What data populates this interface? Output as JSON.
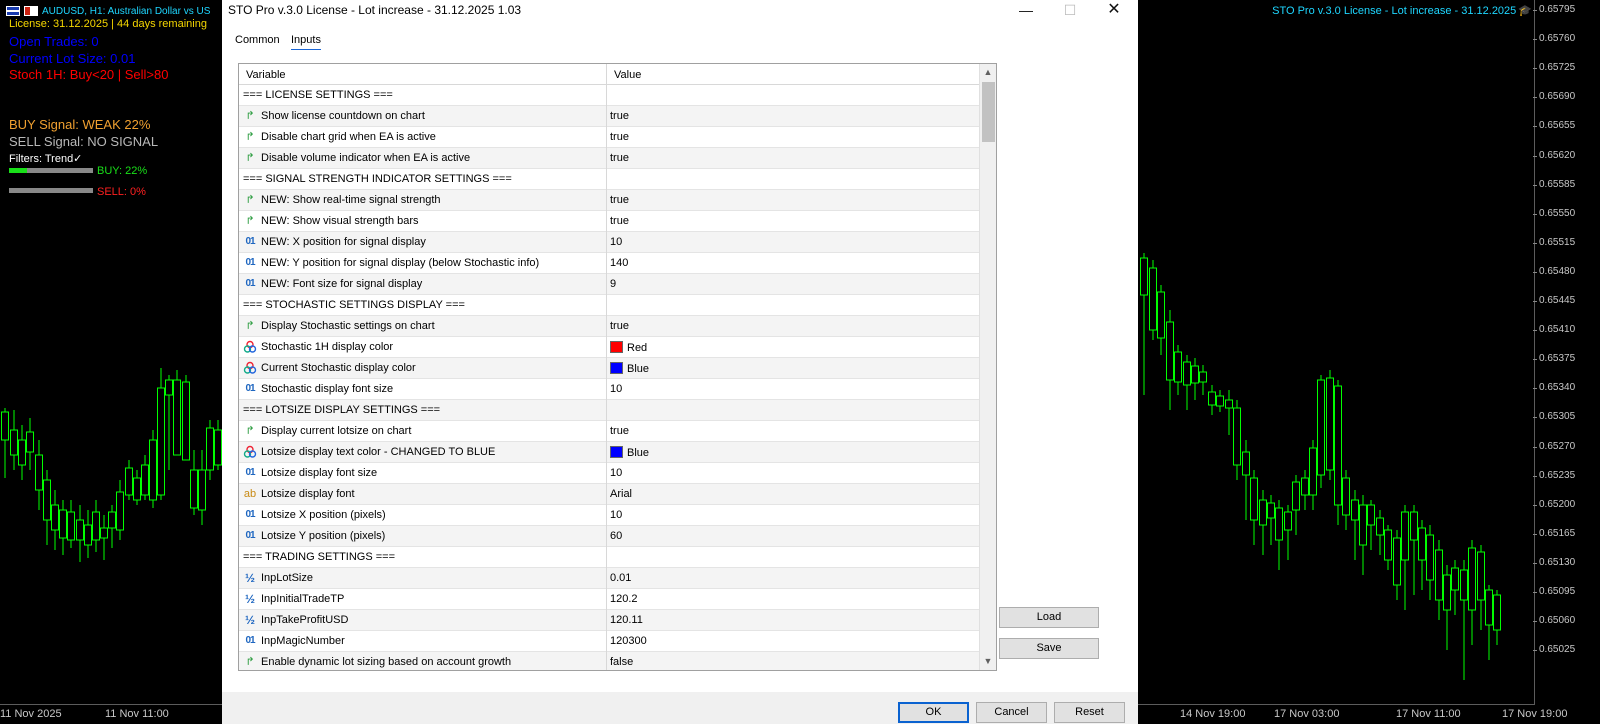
{
  "left_chart": {
    "symbol_title": "AUDUSD, H1:  Australian Dollar vs US",
    "license_line": "License: 31.12.2025 | 44 days remaining",
    "open_trades": "Open Trades: 0",
    "current_lot": "Current Lot Size: 0.01",
    "stoch_line": "Stoch 1H: Buy<20 | Sell>80",
    "buy_signal": "BUY Signal: WEAK 22%",
    "sell_signal": "SELL Signal: NO SIGNAL",
    "filters": "Filters: Trend✓",
    "buy_bar_label": "BUY: 22%",
    "sell_bar_label": "SELL: 0%",
    "buy_strength": 0.22,
    "sell_strength": 0.0,
    "time_labels": [
      "11 Nov 2025",
      "11 Nov 11:00"
    ]
  },
  "right_chart": {
    "title": "STO Pro v.3.0 License - Lot increase - 31.12.2025",
    "hat_icon": "graduation-cap-icon",
    "price_labels": [
      "0.65795",
      "0.65760",
      "0.65725",
      "0.65690",
      "0.65655",
      "0.65620",
      "0.65585",
      "0.65550",
      "0.65515",
      "0.65480",
      "0.65445",
      "0.65410",
      "0.65375",
      "0.65340",
      "0.65305",
      "0.65270",
      "0.65235",
      "0.65200",
      "0.65165",
      "0.65130",
      "0.65095",
      "0.65060",
      "0.65025"
    ],
    "time_labels": [
      "14 Nov 19:00",
      "17 Nov 03:00",
      "17 Nov 11:00",
      "17 Nov 19:00"
    ]
  },
  "dialog": {
    "title": "STO Pro v.3.0 License - Lot increase - 31.12.2025 1.03",
    "window_controls": {
      "minimize": "—",
      "maximize": "☐",
      "close": "✕"
    },
    "tabs": [
      {
        "label": "Common",
        "active": false
      },
      {
        "label": "Inputs",
        "active": true
      }
    ],
    "columns": {
      "variable": "Variable",
      "value": "Value"
    },
    "buttons": {
      "load": "Load",
      "save": "Save",
      "ok": "OK",
      "cancel": "Cancel",
      "reset": "Reset"
    },
    "rows": [
      {
        "type": "header",
        "variable": "=== LICENSE SETTINGS ===",
        "value": ""
      },
      {
        "type": "bool",
        "variable": "Show license countdown on chart",
        "value": "true"
      },
      {
        "type": "bool",
        "variable": "Disable chart grid when EA is active",
        "value": "true"
      },
      {
        "type": "bool",
        "variable": "Disable volume indicator when EA is active",
        "value": "true"
      },
      {
        "type": "header",
        "variable": "=== SIGNAL STRENGTH INDICATOR SETTINGS ===",
        "value": ""
      },
      {
        "type": "bool",
        "variable": "NEW: Show real-time signal strength",
        "value": "true"
      },
      {
        "type": "bool",
        "variable": "NEW: Show visual strength bars",
        "value": "true"
      },
      {
        "type": "int",
        "variable": "NEW: X position for signal display",
        "value": "10"
      },
      {
        "type": "int",
        "variable": "NEW: Y position for signal display (below Stochastic info)",
        "value": "140"
      },
      {
        "type": "int",
        "variable": "NEW: Font size for signal display",
        "value": "9"
      },
      {
        "type": "header",
        "variable": "=== STOCHASTIC SETTINGS DISPLAY ===",
        "value": ""
      },
      {
        "type": "bool",
        "variable": "Display Stochastic settings on chart",
        "value": "true"
      },
      {
        "type": "color",
        "variable": "Stochastic 1H display color",
        "value": "Red",
        "swatch": "#ff0000"
      },
      {
        "type": "color",
        "variable": "Current Stochastic display color",
        "value": "Blue",
        "swatch": "#0000ff"
      },
      {
        "type": "int",
        "variable": "Stochastic display font size",
        "value": "10"
      },
      {
        "type": "header",
        "variable": "=== LOTSIZE DISPLAY SETTINGS ===",
        "value": ""
      },
      {
        "type": "bool",
        "variable": "Display current lotsize on chart",
        "value": "true"
      },
      {
        "type": "color",
        "variable": "Lotsize display text color - CHANGED TO BLUE",
        "value": "Blue",
        "swatch": "#0000ff"
      },
      {
        "type": "int",
        "variable": "Lotsize display font size",
        "value": "10"
      },
      {
        "type": "string",
        "variable": "Lotsize display font",
        "value": "Arial"
      },
      {
        "type": "int",
        "variable": "Lotsize X position (pixels)",
        "value": "10"
      },
      {
        "type": "int",
        "variable": "Lotsize Y position (pixels)",
        "value": "60"
      },
      {
        "type": "header",
        "variable": "=== TRADING SETTINGS ===",
        "value": ""
      },
      {
        "type": "double",
        "variable": "InpLotSize",
        "value": "0.01"
      },
      {
        "type": "double",
        "variable": "InpInitialTradeTP",
        "value": "120.2"
      },
      {
        "type": "double",
        "variable": "InpTakeProfitUSD",
        "value": "120.11"
      },
      {
        "type": "int",
        "variable": "InpMagicNumber",
        "value": "120300"
      },
      {
        "type": "bool",
        "variable": "Enable dynamic lot sizing based on account growth",
        "value": "false"
      }
    ]
  },
  "icons": {
    "bool": "green-arrow-icon",
    "int": "integer-01-icon",
    "double": "fraction-half-icon",
    "string": "text-ab-icon",
    "color": "color-circles-icon"
  },
  "colors": {
    "candle_bull": "#00ff00",
    "info_cyan": "#1ed6ff",
    "accent_blue": "#0a62d0"
  }
}
